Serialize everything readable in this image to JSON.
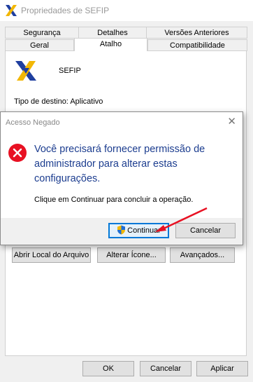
{
  "window": {
    "title": "Propriedades de SEFIP",
    "tabs_top": [
      "Segurança",
      "Detalhes",
      "Versões Anteriores"
    ],
    "tabs_bottom": [
      "Geral",
      "Atalho",
      "Compatibilidade"
    ],
    "active_tab": "Atalho",
    "app_name": "SEFIP",
    "tipo_destino": "Tipo de destino: Aplicativo",
    "buttons": {
      "open_location": "Abrir Local do Arquivo",
      "change_icon": "Alterar Ícone...",
      "advanced": "Avançados..."
    },
    "footer": {
      "ok": "OK",
      "cancel": "Cancelar",
      "apply": "Aplicar"
    }
  },
  "dialog": {
    "title": "Acesso Negado",
    "close_glyph": "✕",
    "message": "Você precisará fornecer permissão de administrador para alterar estas configurações.",
    "sub": "Clique em Continuar para concluir a operação.",
    "continue_label": "Continuar",
    "cancel_label": "Cancelar"
  },
  "colors": {
    "accent": "#0078d7",
    "message_text": "#1c3d8f",
    "error_red": "#e81123",
    "arrow_red": "#e81123"
  }
}
